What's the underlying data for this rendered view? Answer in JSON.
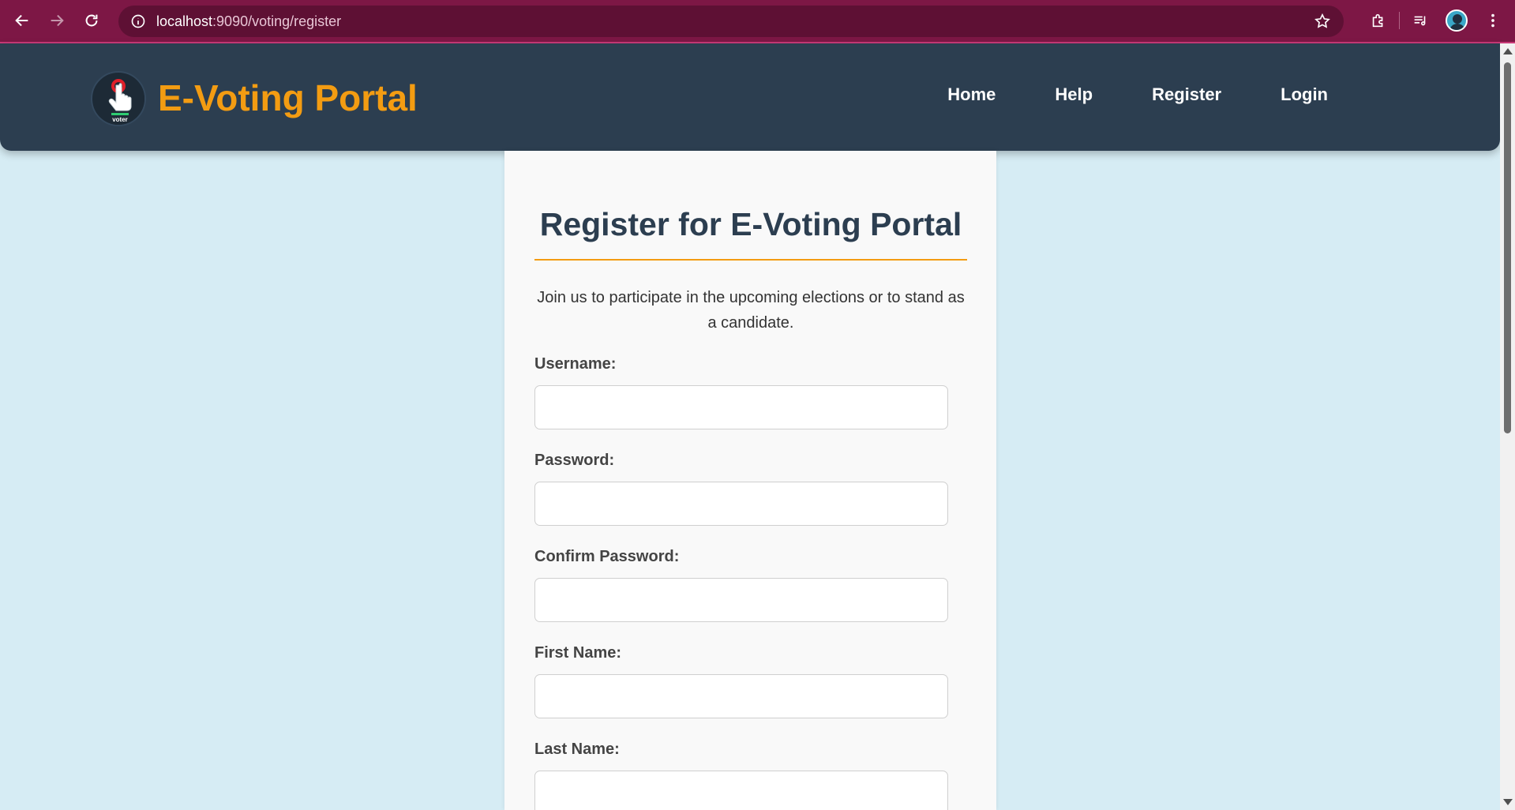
{
  "browser": {
    "url_host": "localhost",
    "url_path": ":9090/voting/register"
  },
  "site": {
    "brand": "E-Voting Portal",
    "logo_text": "voter",
    "nav": [
      {
        "label": "Home"
      },
      {
        "label": "Help"
      },
      {
        "label": "Register"
      },
      {
        "label": "Login"
      }
    ]
  },
  "form": {
    "title": "Register for E-Voting Portal",
    "intro": "Join us to participate in the upcoming elections or to stand as a candidate.",
    "fields": [
      {
        "label": "Username:",
        "value": ""
      },
      {
        "label": "Password:",
        "value": ""
      },
      {
        "label": "Confirm Password:",
        "value": ""
      },
      {
        "label": "First Name:",
        "value": ""
      },
      {
        "label": "Last Name:",
        "value": ""
      }
    ]
  },
  "colors": {
    "browser_chrome": "#7d1745",
    "header_bg": "#2c3e50",
    "brand_orange": "#f39c12",
    "page_bg": "#d6ecf4"
  }
}
